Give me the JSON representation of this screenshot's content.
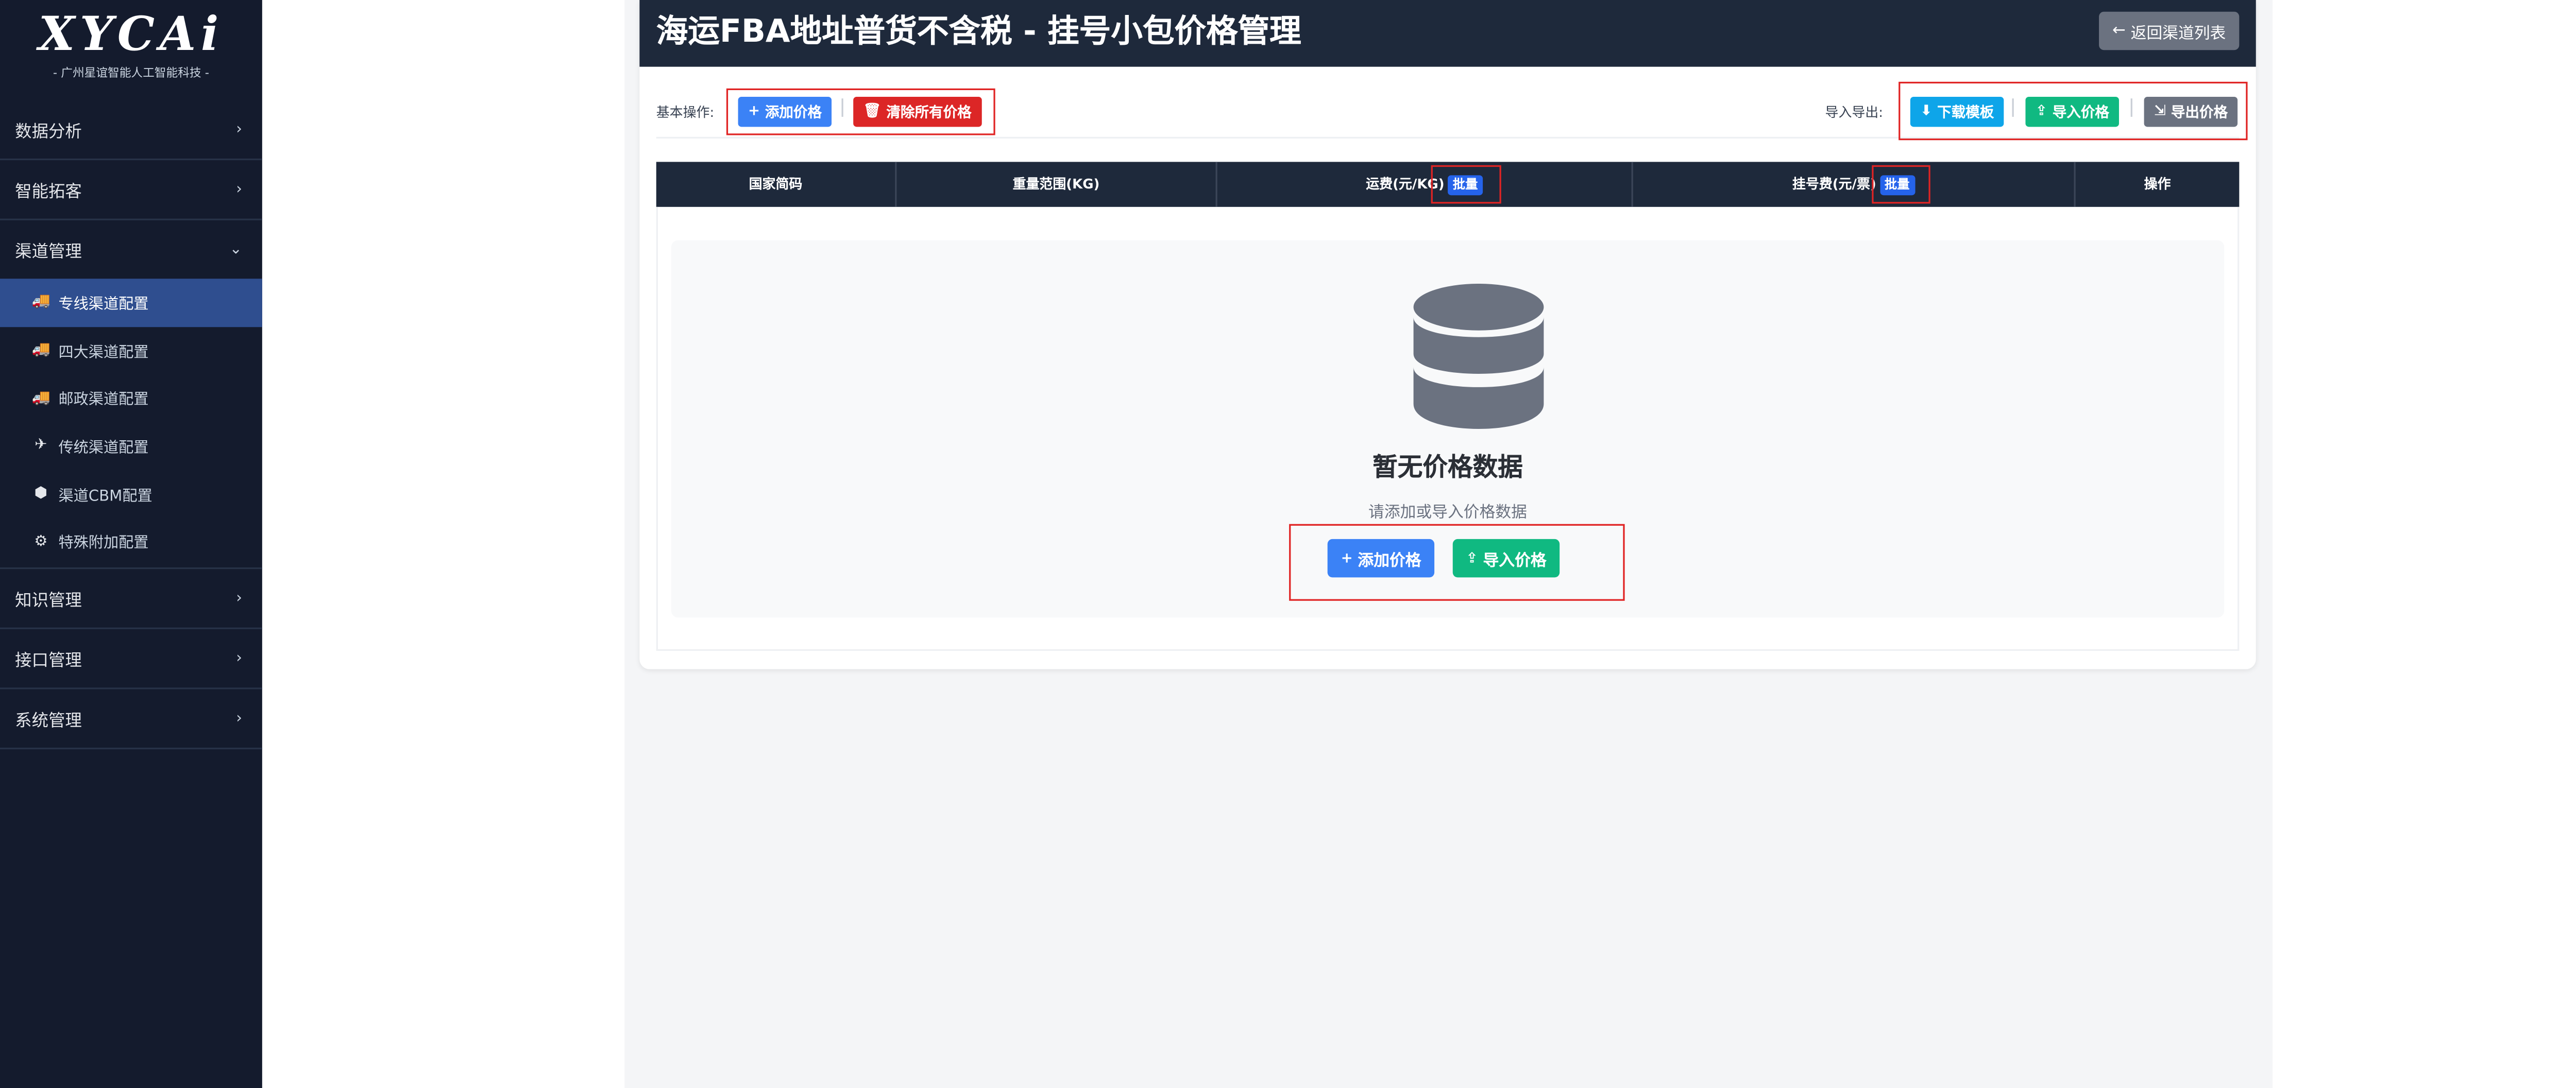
{
  "sidebar": {
    "logo_text": "XYCAi",
    "logo_subtitle": "- 广州星谊智能人工智能科技 -",
    "groups": [
      {
        "label": "数据分析",
        "chevron": "›"
      },
      {
        "label": "智能拓客",
        "chevron": "›"
      },
      {
        "label": "渠道管理",
        "chevron": "⌄"
      }
    ],
    "subitems": [
      {
        "icon": "🚚",
        "label": "专线渠道配置"
      },
      {
        "icon": "🚚",
        "label": "四大渠道配置"
      },
      {
        "icon": "🚚",
        "label": "邮政渠道配置"
      },
      {
        "icon": "✈",
        "label": "传统渠道配置"
      },
      {
        "icon": "⬢",
        "label": "渠道CBM配置"
      },
      {
        "icon": "⚙",
        "label": "特殊附加配置"
      }
    ],
    "groups_after": [
      {
        "label": "知识管理",
        "chevron": "›"
      },
      {
        "label": "接口管理",
        "chevron": "›"
      },
      {
        "label": "系统管理",
        "chevron": "›"
      }
    ]
  },
  "header": {
    "title": "海运FBA地址普货不含税 - 挂号小包价格管理",
    "back_icon": "←",
    "back_label": "返回渠道列表"
  },
  "ops": {
    "basic_label": "基本操作:",
    "add_icon": "+",
    "add_label": "添加价格",
    "clear_icon": "🗑",
    "clear_label": "清除所有价格",
    "import_export_label": "导入导出:",
    "download_icon": "⬇",
    "download_label": "下载模板",
    "import_icon": "⇪",
    "import_label": "导入价格",
    "export_icon": "⇲",
    "export_label": "导出价格"
  },
  "table": {
    "headers": [
      "国家简码",
      "重量范围(KG)",
      "运费(元/KG)",
      "挂号费(元/票)",
      "操作"
    ],
    "batch_label": "批量"
  },
  "empty_state": {
    "icon": "database-icon",
    "title": "暂无价格数据",
    "subtitle": "请添加或导入价格数据",
    "add_icon": "+",
    "add_label": "添加价格",
    "import_icon": "⇪",
    "import_label": "导入价格"
  }
}
